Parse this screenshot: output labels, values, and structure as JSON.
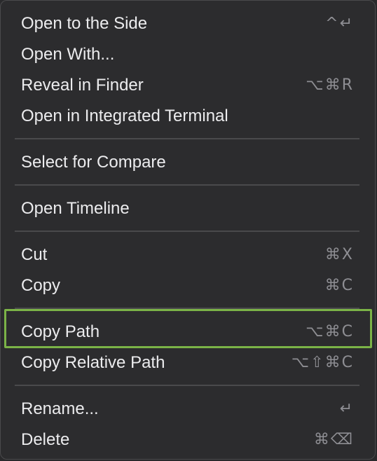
{
  "menu": {
    "items": [
      {
        "label": "Open to the Side",
        "shortcut": [
          "^",
          "↵"
        ]
      },
      {
        "label": "Open With...",
        "shortcut": []
      },
      {
        "label": "Reveal in Finder",
        "shortcut": [
          "⌥",
          "⌘",
          "R"
        ]
      },
      {
        "label": "Open in Integrated Terminal",
        "shortcut": []
      },
      {
        "label": "Select for Compare",
        "shortcut": []
      },
      {
        "label": "Open Timeline",
        "shortcut": []
      },
      {
        "label": "Cut",
        "shortcut": [
          "⌘",
          "X"
        ]
      },
      {
        "label": "Copy",
        "shortcut": [
          "⌘",
          "C"
        ]
      },
      {
        "label": "Copy Path",
        "shortcut": [
          "⌥",
          "⌘",
          "C"
        ]
      },
      {
        "label": "Copy Relative Path",
        "shortcut": [
          "⌥",
          "⇧",
          "⌘",
          "C"
        ]
      },
      {
        "label": "Rename...",
        "shortcut": [
          "↵"
        ]
      },
      {
        "label": "Delete",
        "shortcut": [
          "⌘",
          "⌫"
        ]
      }
    ]
  },
  "colors": {
    "background": "#2c2c2e",
    "text": "#ececee",
    "shortcut": "#8e8e93",
    "separator": "#4a4a4c",
    "highlight_border": "#7bb347"
  }
}
